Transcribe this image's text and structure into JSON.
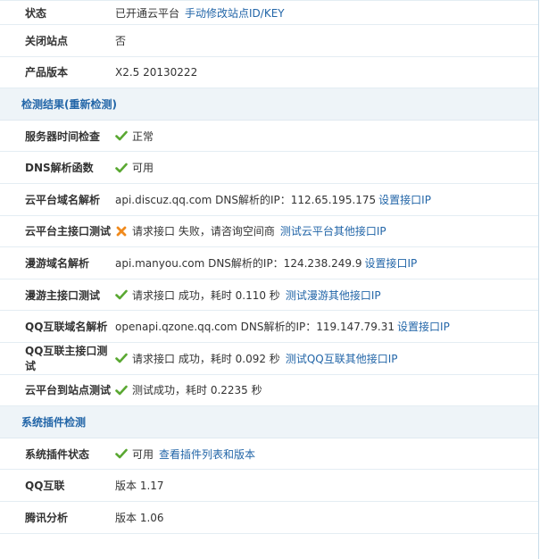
{
  "rows_top": [
    {
      "label": "状态",
      "value": "已开通云平台",
      "link": "手动修改站点ID/KEY"
    },
    {
      "label": "关闭站点",
      "value": "否"
    },
    {
      "label": "产品版本",
      "value": "X2.5 20130222"
    }
  ],
  "section_detect": {
    "title": "检测结果(重新检测)"
  },
  "rows_detect": [
    {
      "label": "服务器时间检查",
      "status": "ok",
      "value": "正常"
    },
    {
      "label": "DNS解析函数",
      "status": "ok",
      "value": "可用"
    },
    {
      "label": "云平台域名解析",
      "value": "api.discuz.qq.com DNS解析的IP：112.65.195.175",
      "link": "设置接口IP"
    },
    {
      "label": "云平台主接口测试",
      "status": "fail",
      "value": "请求接口 失败，请咨询空间商",
      "link": "测试云平台其他接口IP"
    },
    {
      "label": "漫游域名解析",
      "value": "api.manyou.com DNS解析的IP：124.238.249.9",
      "link": "设置接口IP"
    },
    {
      "label": "漫游主接口测试",
      "status": "ok",
      "value": "请求接口 成功，耗时 0.110 秒",
      "link": "测试漫游其他接口IP"
    },
    {
      "label": "QQ互联域名解析",
      "value": "openapi.qzone.qq.com DNS解析的IP：119.147.79.31",
      "link": "设置接口IP"
    },
    {
      "label": "QQ互联主接口测试",
      "status": "ok",
      "value": "请求接口 成功，耗时 0.092 秒",
      "link": "测试QQ互联其他接口IP"
    },
    {
      "label": "云平台到站点测试",
      "status": "ok",
      "value": "测试成功，耗时 0.2235 秒"
    }
  ],
  "section_plugins": {
    "title": "系统插件检测"
  },
  "rows_plugins": [
    {
      "label": "系统插件状态",
      "status": "ok",
      "value": "可用",
      "link": "查看插件列表和版本"
    },
    {
      "label": "QQ互联",
      "value": "版本 1.17"
    },
    {
      "label": "腾讯分析",
      "value": "版本 1.06"
    }
  ],
  "colors": {
    "ok": "#5aa832",
    "fail": "#f08a1c",
    "link": "#2366a8",
    "section_bg": "#eef4f8"
  }
}
